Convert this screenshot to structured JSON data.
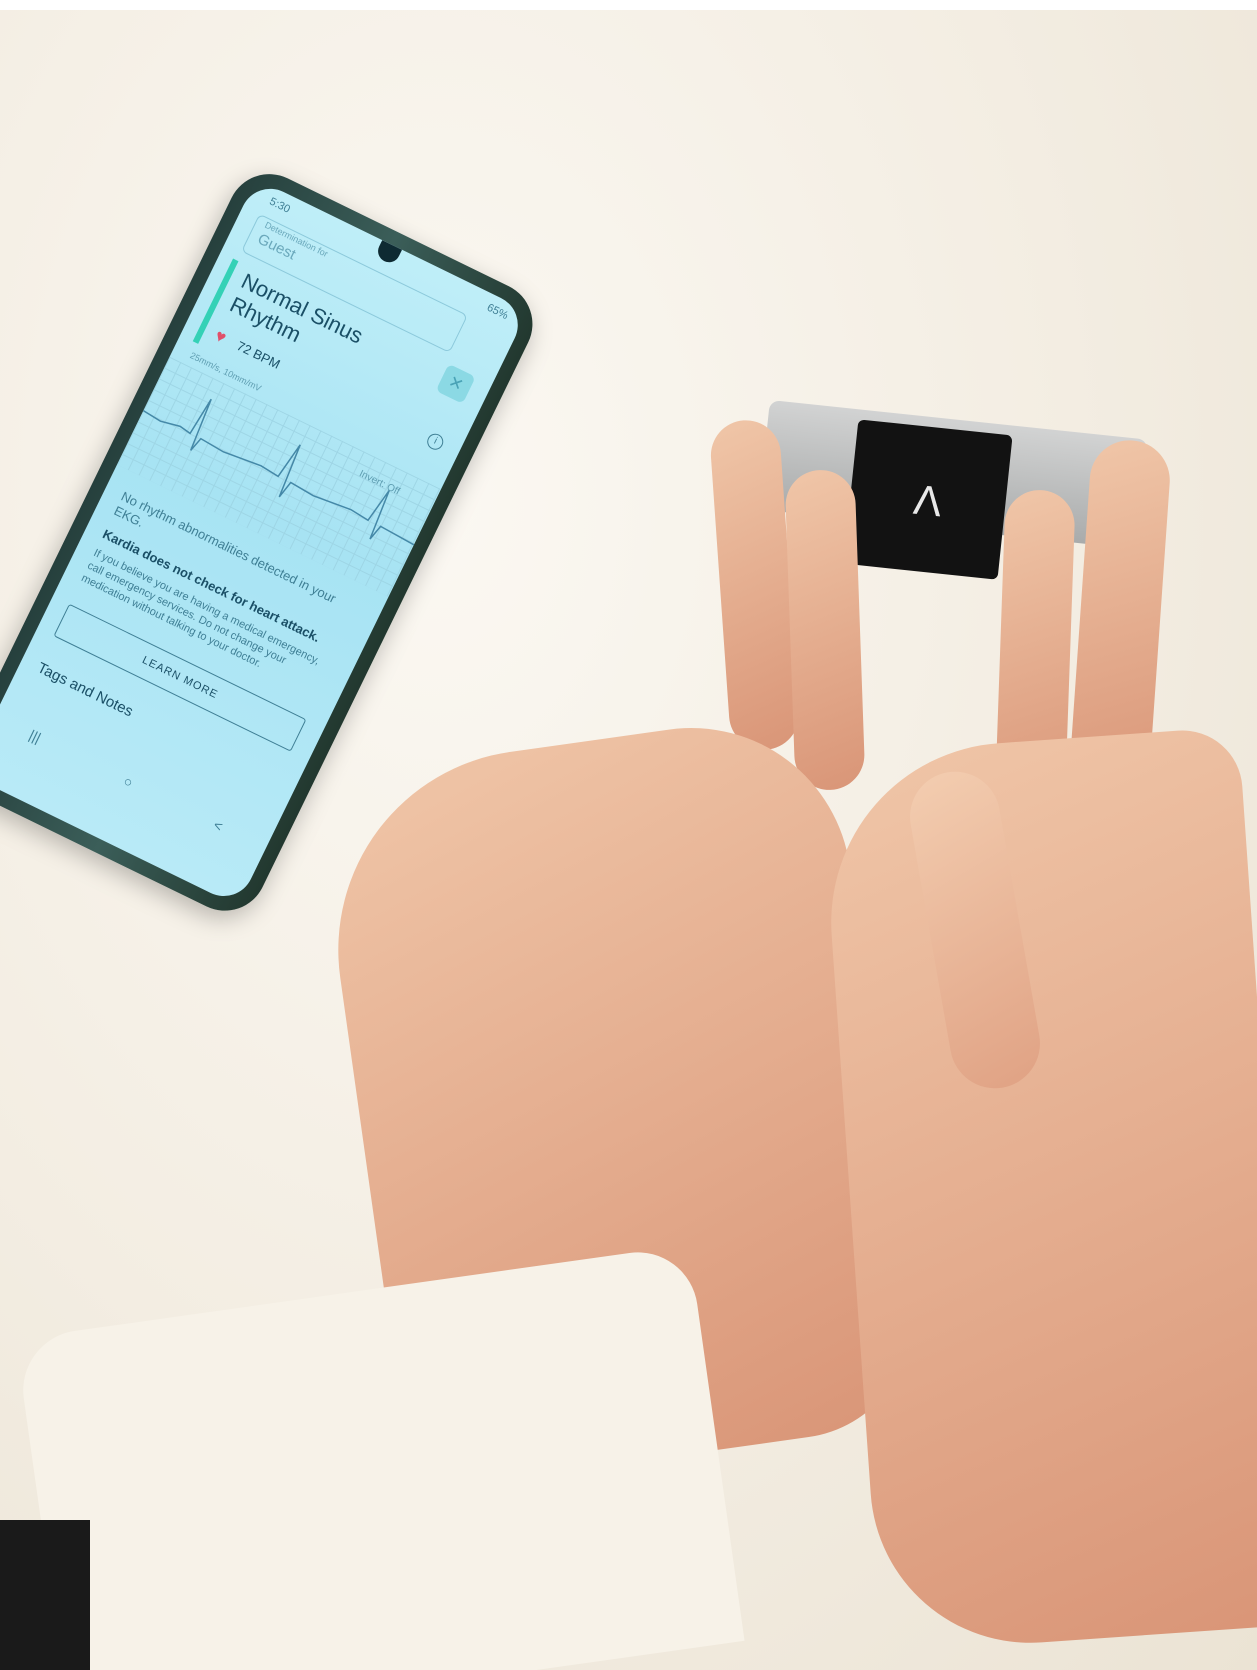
{
  "phone": {
    "status_time": "5:30",
    "status_right": "65%",
    "determination_label": "Determination for",
    "determination_value": "Guest",
    "result_title": "Normal Sinus Rhythm",
    "heart_rate": "72 BPM",
    "info_glyph": "i",
    "scale_label": "25mm/s, 10mm/mV",
    "invert_label": "Invert: Off",
    "message": "No rhythm abnormalities detected in your EKG.",
    "warning_title": "Kardia does not check for heart attack.",
    "warning_body": "If you believe you are having a medical emergency, call emergency services. Do not change your medication without talking to your doctor.",
    "learn_more_label": "LEARN MORE",
    "tags_label": "Tags and Notes",
    "nav_recent": "|||",
    "nav_home": "○",
    "nav_back": "<",
    "close_glyph": "✕",
    "heart_glyph": "♥",
    "accent_color": "#34d1b6",
    "heart_color": "#e0506a"
  },
  "device": {
    "logo_glyph": "Λ"
  }
}
